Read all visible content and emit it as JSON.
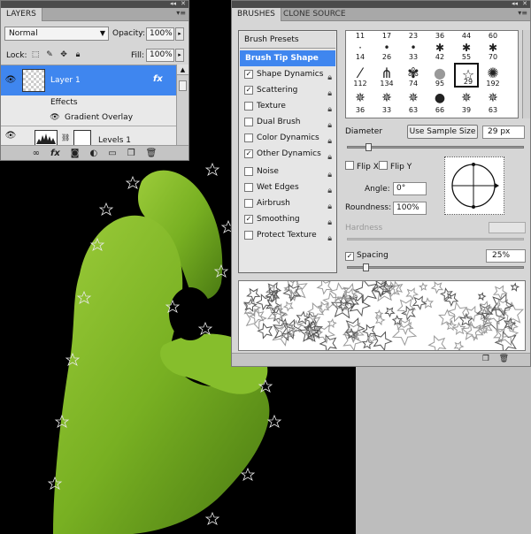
{
  "colors": {
    "accent": "#3f86ef",
    "panel": "#d6d6d6",
    "hand": "#7fb82a"
  },
  "layers_panel": {
    "tab": "LAYERS",
    "blend_mode": "Normal",
    "opacity_label": "Opacity:",
    "opacity_value": "100%",
    "lock_label": "Lock:",
    "fill_label": "Fill:",
    "fill_value": "100%",
    "layers": [
      {
        "name": "Layer 1",
        "fx": "fx"
      },
      {
        "name": "Effects"
      },
      {
        "name": "Gradient Overlay"
      },
      {
        "name": "Levels 1"
      }
    ],
    "icons": [
      "link-icon",
      "fx-icon",
      "mask-icon",
      "adjustment-icon",
      "folder-icon",
      "new-layer-icon",
      "trash-icon"
    ]
  },
  "brushes_panel": {
    "tabs": [
      "BRUSHES",
      "CLONE SOURCE"
    ],
    "presets_label": "Brush Presets",
    "options": [
      {
        "label": "Brush Tip Shape",
        "selected": true
      },
      {
        "label": "Shape Dynamics",
        "checked": true
      },
      {
        "label": "Scattering",
        "checked": true
      },
      {
        "label": "Texture",
        "checked": false
      },
      {
        "label": "Dual Brush",
        "checked": false
      },
      {
        "label": "Color Dynamics",
        "checked": false
      },
      {
        "label": "Other Dynamics",
        "checked": true
      },
      {
        "label": "Noise",
        "checked": false
      },
      {
        "label": "Wet Edges",
        "checked": false
      },
      {
        "label": "Airbrush",
        "checked": false
      },
      {
        "label": "Smoothing",
        "checked": true
      },
      {
        "label": "Protect Texture",
        "checked": false
      }
    ],
    "tip_sizes_row0": [
      "11",
      "17",
      "23",
      "36",
      "44",
      "60"
    ],
    "tip_sizes_row1": [
      "14",
      "26",
      "33",
      "42",
      "55",
      "70"
    ],
    "tip_sizes_row2": [
      "112",
      "134",
      "74",
      "95",
      "29",
      "192"
    ],
    "tip_sizes_row3": [
      "36",
      "33",
      "63",
      "66",
      "39",
      "63"
    ],
    "diameter_label": "Diameter",
    "use_sample_size": "Use Sample Size",
    "diameter_value": "29 px",
    "flip_x": "Flip X",
    "flip_y": "Flip Y",
    "angle_label": "Angle:",
    "angle_value": "0°",
    "roundness_label": "Roundness:",
    "roundness_value": "100%",
    "hardness_label": "Hardness",
    "spacing_label": "Spacing",
    "spacing_value": "25%"
  }
}
